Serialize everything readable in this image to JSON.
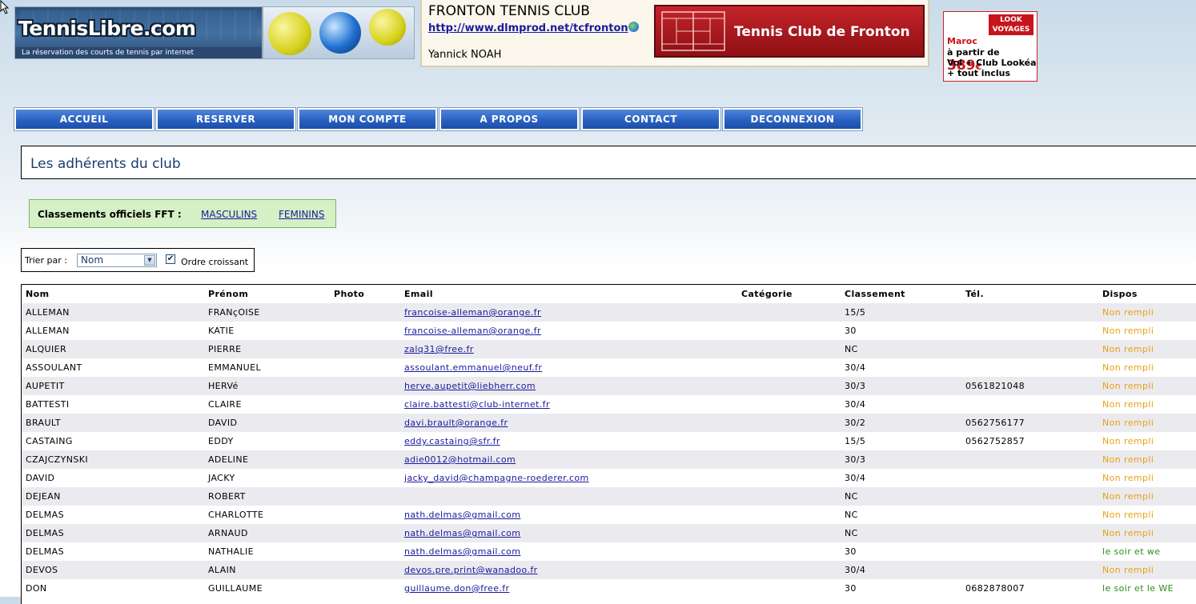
{
  "header": {
    "logo_name": "TennisLibre.com",
    "logo_tagline": "La réservation des courts de tennis par internet",
    "club_name": "FRONTON TENNIS CLUB",
    "club_url": "http://www.dlmprod.net/tcfronton",
    "club_contact": "Yannick NOAH",
    "club_banner": "Tennis Club de Fronton"
  },
  "ad": {
    "logo_line1": "LOOK",
    "logo_line2": "VOYAGES",
    "line1": "Maroc",
    "line2_prefix": "à partir de ",
    "price": "389",
    "currency": "€",
    "line3": "Vol + Club Lookéa",
    "line4": "+ tout inclus"
  },
  "nav": {
    "items": [
      "ACCUEIL",
      "RESERVER",
      "MON COMPTE",
      "A PROPOS",
      "CONTACT",
      "DECONNEXION"
    ]
  },
  "page": {
    "title": "Les adhérents du club"
  },
  "fft": {
    "label": "Classements officiels FFT :",
    "link_men": "MASCULINS",
    "link_women": "FEMININS"
  },
  "sort": {
    "label": "Trier par :",
    "selected": "Nom",
    "order_label": "Ordre croissant",
    "order_checked": true
  },
  "table": {
    "columns": [
      "Nom",
      "Prénom",
      "Photo",
      "Email",
      "Catégorie",
      "Classement",
      "Tél.",
      "Dispos"
    ],
    "rows": [
      {
        "nom": "ALLEMAN",
        "prenom": "FRANçOISE",
        "email": "francoise-alleman@orange.fr",
        "classement": "15/5",
        "tel": "",
        "dispos": "Non rempli"
      },
      {
        "nom": "ALLEMAN",
        "prenom": "KATIE",
        "email": "francoise-alleman@orange.fr",
        "classement": "30",
        "tel": "",
        "dispos": "Non rempli"
      },
      {
        "nom": "ALQUIER",
        "prenom": "PIERRE",
        "email": "zalq31@free.fr",
        "classement": "NC",
        "tel": "",
        "dispos": "Non rempli"
      },
      {
        "nom": "ASSOULANT",
        "prenom": "EMMANUEL",
        "email": "assoulant.emmanuel@neuf.fr",
        "classement": "30/4",
        "tel": "",
        "dispos": "Non rempli"
      },
      {
        "nom": "AUPETIT",
        "prenom": "HERVé",
        "email": "herve.aupetit@liebherr.com",
        "classement": "30/3",
        "tel": "0561821048",
        "dispos": "Non rempli"
      },
      {
        "nom": "BATTESTI",
        "prenom": "CLAIRE",
        "email": "claire.battesti@club-internet.fr",
        "classement": "30/4",
        "tel": "",
        "dispos": "Non rempli"
      },
      {
        "nom": "BRAULT",
        "prenom": "DAVID",
        "email": "davi.brault@orange.fr",
        "classement": "30/2",
        "tel": "0562756177",
        "dispos": "Non rempli"
      },
      {
        "nom": "CASTAING",
        "prenom": "EDDY",
        "email": "eddy.castaing@sfr.fr",
        "classement": "15/5",
        "tel": "0562752857",
        "dispos": "Non rempli"
      },
      {
        "nom": "CZAJCZYNSKI",
        "prenom": "ADELINE",
        "email": "adie0012@hotmail.com",
        "classement": "30/3",
        "tel": "",
        "dispos": "Non rempli"
      },
      {
        "nom": "DAVID",
        "prenom": "JACKY",
        "email": "jacky_david@champagne-roederer.com",
        "classement": "30/4",
        "tel": "",
        "dispos": "Non rempli"
      },
      {
        "nom": "DEJEAN",
        "prenom": "ROBERT",
        "email": "",
        "classement": "NC",
        "tel": "",
        "dispos": "Non rempli"
      },
      {
        "nom": "DELMAS",
        "prenom": "CHARLOTTE",
        "email": "nath.delmas@gmail.com",
        "classement": "NC",
        "tel": "",
        "dispos": "Non rempli"
      },
      {
        "nom": "DELMAS",
        "prenom": "ARNAUD",
        "email": "nath.delmas@gmail.com",
        "classement": "NC",
        "tel": "",
        "dispos": "Non rempli"
      },
      {
        "nom": "DELMAS",
        "prenom": "NATHALIE",
        "email": "nath.delmas@gmail.com",
        "classement": "30",
        "tel": "",
        "dispos": "le soir et we"
      },
      {
        "nom": "DEVOS",
        "prenom": "ALAIN",
        "email": "devos.pre.print@wanadoo.fr",
        "classement": "30/4",
        "tel": "",
        "dispos": "Non rempli"
      },
      {
        "nom": "DON",
        "prenom": "GUILLAUME",
        "email": "guillaume.don@free.fr",
        "classement": "30",
        "tel": "0682878007",
        "dispos": "le soir et le WE"
      }
    ]
  },
  "colors": {
    "nav_blue": "#2961c2",
    "dispo_empty": "#e8a113",
    "dispo_filled": "#2a8f1a",
    "row_alt": "#ebeaef"
  }
}
